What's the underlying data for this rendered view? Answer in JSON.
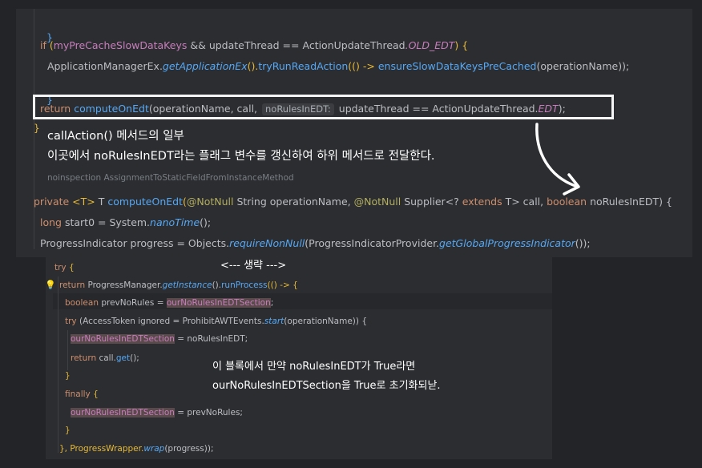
{
  "top_code": {
    "l1_brace": "}",
    "l2_if": "if",
    "l2_open": " (",
    "l2_var": "myPreCacheSlowDataKeys",
    "l2_and": " && ",
    "l2_var2": "updateThread",
    "l2_eq": " == ",
    "l2_cls": "ActionUpdateThread",
    "l2_const": ".OLD_EDT",
    "l2_close": ") {",
    "l3_cls": "ApplicationManagerEx",
    "l3_dot": ".",
    "l3_fn": "getApplicationEx",
    "l3_rest1": "().",
    "l3_fn2": "tryRunReadAction",
    "l3_rest2": "(() -> ",
    "l3_fn3": "ensureSlowDataKeysPreCached",
    "l3_rest3": "(operationName));",
    "l4_brace": "}",
    "l5_return": "return ",
    "l5_fn": "computeOnEdt",
    "l5_args": "(operationName, call, ",
    "l5_hint": "noRulesInEDT:",
    "l5_rest": " updateThread == ActionUpdateThread.",
    "l5_const": "EDT",
    "l5_end": ");",
    "l6_brace": "}",
    "noinspection": "noinspection AssignmentToStaticFieldFromInstanceMethod",
    "l8_private": "private ",
    "l8_generic": "<T> ",
    "l8_t": "T ",
    "l8_fn": "computeOnEdt",
    "l8_p1": "(",
    "l8_anno1": "@NotNull",
    "l8_p2": " String operationName, ",
    "l8_anno2": "@NotNull",
    "l8_p3": " Supplier<? ",
    "l8_extends": "extends",
    "l8_p4": " T> call, ",
    "l8_boolean": "boolean",
    "l8_p5": " noRulesInEDT) {",
    "l9_long": "long",
    "l9_rest": " start0 = System.",
    "l9_fn": "nanoTime",
    "l9_end": "();",
    "l10_cls": "ProgressIndicator progress = Objects.",
    "l10_fn": "requireNonNull",
    "l10_mid": "(ProgressIndicatorProvider.",
    "l10_fn2": "getGlobalProgressIndicator",
    "l10_end": "());"
  },
  "captions": {
    "title": "callAction() 메서드의 일부",
    "desc": "이곳에서 noRulesInEDT라는 플래그 변수를 갱신하여 하위 메서드로 전달한다.",
    "omitted": "<--- 생략 --->",
    "note1": "이 블록에서 만약 noRulesInEDT가 True라면",
    "note2": "ourNoRulesInEDTSection을 True로 초기화되낟."
  },
  "bottom_code": {
    "b1_try": "try",
    "b1_brace": " {",
    "b2_return": "return ",
    "b2_cls": "ProgressManager.",
    "b2_fn": "getInstance",
    "b2_mid": "().",
    "b2_fn2": "runProcess",
    "b2_end": "(() -> {",
    "b3_boolean": "boolean",
    "b3_mid": " prevNoRules = ",
    "b3_var": "ourNoRulesInEDTSection",
    "b3_end": ";",
    "b4_try": "try",
    "b4_mid": " (AccessToken ignored = ProhibitAWTEvents.",
    "b4_fn": "start",
    "b4_end": "(operationName)) {",
    "b5_var": "ourNoRulesInEDTSection",
    "b5_end": " = noRulesInEDT;",
    "b6_return": "return ",
    "b6_rest": "call.",
    "b6_fn": "get",
    "b6_end": "();",
    "b7_brace": "}",
    "b8_finally": "finally",
    "b8_brace": " {",
    "b9_var": "ourNoRulesInEDTSection",
    "b9_end": " = prevNoRules;",
    "b10_brace": "}",
    "b11_start": "}, ProgressWrapper.",
    "b11_fn": "wrap",
    "b11_end": "(progress));"
  },
  "colors": {
    "keyword": "#cf8e6d",
    "function": "#56a8f5",
    "annotation": "#b3ae60",
    "static_field": "#c77dbb",
    "highlight_box": "#f5f5f5"
  },
  "icons": {
    "bulb": "lightbulb-icon",
    "arrow": "curved-arrow-icon"
  }
}
